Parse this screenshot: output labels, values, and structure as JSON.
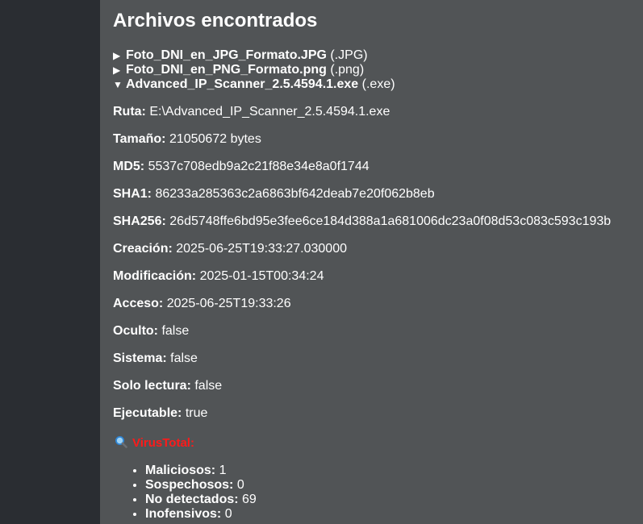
{
  "page": {
    "title": "Archivos encontrados"
  },
  "files": [
    {
      "name": "Foto_DNI_en_JPG_Formato.JPG",
      "ext": "(.JPG)",
      "arrow": "▶"
    },
    {
      "name": "Foto_DNI_en_PNG_Formato.png",
      "ext": "(.png)",
      "arrow": "▶"
    },
    {
      "name": "Advanced_IP_Scanner_2.5.4594.1.exe",
      "ext": "(.exe)",
      "arrow": "▼"
    }
  ],
  "details": [
    {
      "label": "Ruta:",
      "value": "E:\\Advanced_IP_Scanner_2.5.4594.1.exe"
    },
    {
      "label": "Tamaño:",
      "value": "21050672 bytes"
    },
    {
      "label": "MD5:",
      "value": "5537c708edb9a2c21f88e34e8a0f1744"
    },
    {
      "label": "SHA1:",
      "value": "86233a285363c2a6863bf642deab7e20f062b8eb"
    },
    {
      "label": "SHA256:",
      "value": "26d5748ffe6bd95e3fee6ce184d388a1a681006dc23a0f08d53c083c593c193b"
    },
    {
      "label": "Creación:",
      "value": "2025-06-25T19:33:27.030000"
    },
    {
      "label": "Modificación:",
      "value": "2025-01-15T00:34:24"
    },
    {
      "label": "Acceso:",
      "value": "2025-06-25T19:33:26"
    },
    {
      "label": "Oculto:",
      "value": "false"
    },
    {
      "label": "Sistema:",
      "value": "false"
    },
    {
      "label": "Solo lectura:",
      "value": "false"
    },
    {
      "label": "Ejecutable:",
      "value": "true"
    }
  ],
  "virustotal": {
    "icon": "magnifier-icon",
    "label": "VirusTotal:",
    "label_color": "#ff1a1a",
    "stats": [
      {
        "label": "Maliciosos:",
        "value": "1"
      },
      {
        "label": "Sospechosos:",
        "value": "0"
      },
      {
        "label": "No detectados:",
        "value": "69"
      },
      {
        "label": "Inofensivos:",
        "value": "0"
      }
    ]
  }
}
